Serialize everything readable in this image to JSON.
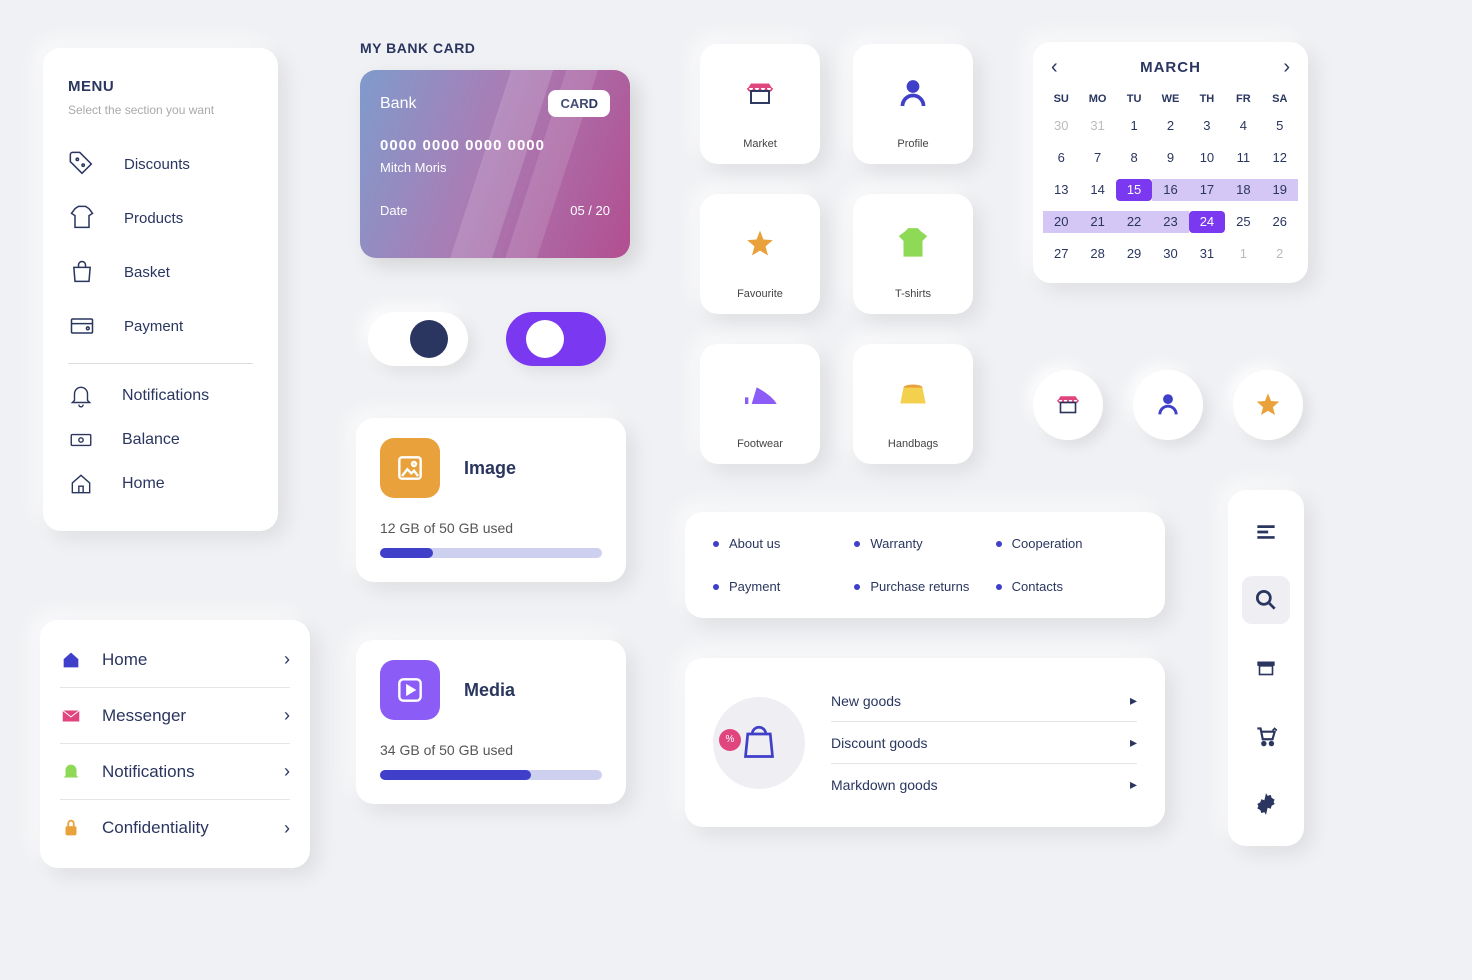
{
  "menu": {
    "title": "MENU",
    "subtitle": "Select the section you want",
    "items": [
      {
        "label": "Discounts"
      },
      {
        "label": "Products"
      },
      {
        "label": "Basket"
      },
      {
        "label": "Payment"
      }
    ],
    "items2": [
      {
        "label": "Notifications"
      },
      {
        "label": "Balance"
      },
      {
        "label": "Home"
      }
    ]
  },
  "nav": {
    "items": [
      {
        "label": "Home"
      },
      {
        "label": "Messenger"
      },
      {
        "label": "Notifications"
      },
      {
        "label": "Confidentiality"
      }
    ]
  },
  "bank": {
    "header": "MY BANK CARD",
    "bank_label": "Bank",
    "card_badge": "CARD",
    "number": "0000 0000 0000 0000",
    "name": "Mitch Moris",
    "date_label": "Date",
    "date": "05 / 20"
  },
  "storage": {
    "image": {
      "title": "Image",
      "usage": "12 GB of 50 GB used",
      "pct": 24
    },
    "media": {
      "title": "Media",
      "usage": "34 GB of 50 GB used",
      "pct": 68
    }
  },
  "tiles": [
    {
      "label": "Market"
    },
    {
      "label": "Profile"
    },
    {
      "label": "Favourite"
    },
    {
      "label": "T-shirts"
    },
    {
      "label": "Footwear"
    },
    {
      "label": "Handbags"
    }
  ],
  "calendar": {
    "month": "MARCH",
    "dow": [
      "SU",
      "MO",
      "TU",
      "WE",
      "TH",
      "FR",
      "SA"
    ],
    "leading": [
      30,
      31
    ],
    "days": [
      1,
      2,
      3,
      4,
      5,
      6,
      7,
      8,
      9,
      10,
      11,
      12,
      13,
      14,
      15,
      16,
      17,
      18,
      19,
      20,
      21,
      22,
      23,
      24,
      25,
      26,
      27,
      28,
      29,
      30,
      31
    ],
    "trailing": [
      1,
      2
    ],
    "range": [
      15,
      16,
      17,
      18,
      19,
      20,
      21,
      22,
      23,
      24
    ],
    "selected": [
      15,
      24
    ]
  },
  "links": [
    "About us",
    "Warranty",
    "Cooperation",
    "Payment",
    "Purchase returns",
    "Contacts"
  ],
  "goods": [
    "New goods",
    "Discount goods",
    "Markdown goods"
  ]
}
